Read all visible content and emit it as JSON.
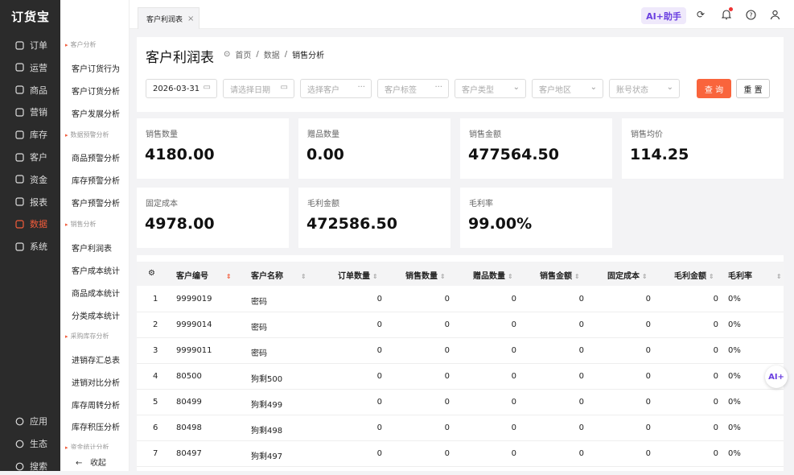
{
  "app": {
    "logo": "订货宝",
    "collapse": "收起"
  },
  "main_nav": [
    {
      "label": "订单",
      "icon": "order-icon"
    },
    {
      "label": "运营",
      "icon": "operation-icon"
    },
    {
      "label": "商品",
      "icon": "goods-icon"
    },
    {
      "label": "营销",
      "icon": "marketing-icon"
    },
    {
      "label": "库存",
      "icon": "warehouse-icon"
    },
    {
      "label": "客户",
      "icon": "customer-icon"
    },
    {
      "label": "资金",
      "icon": "money-icon"
    },
    {
      "label": "报表",
      "icon": "report-icon"
    },
    {
      "label": "数据",
      "icon": "data-icon",
      "active": true
    },
    {
      "label": "系统",
      "icon": "system-icon"
    }
  ],
  "bottom_nav": [
    {
      "label": "应用",
      "icon": "apps-icon"
    },
    {
      "label": "生态",
      "icon": "ecosystem-icon"
    },
    {
      "label": "搜索",
      "icon": "search-icon"
    }
  ],
  "sub_nav": {
    "groups": [
      "客户分析",
      "数据预警分析",
      "销售分析",
      "采购库存分析",
      "资金统计分析"
    ],
    "items": [
      "客户订货行为",
      "客户订货分析",
      "客户发展分析",
      "商品预警分析",
      "库存预警分析",
      "客户预警分析",
      "客户利润表",
      "客户成本统计",
      "商品成本统计",
      "分类成本统计",
      "进销存汇总表",
      "进销对比分析",
      "库存周转分析",
      "库存积压分析"
    ]
  },
  "tabs": [
    {
      "label": "客户利润表",
      "close": "×"
    }
  ],
  "header": {
    "ai_label": "AI+助手"
  },
  "page": {
    "title": "客户利润表",
    "breadcrumb": [
      "首页",
      "数据",
      "销售分析"
    ],
    "sep": "/"
  },
  "filters": {
    "date_start": "2026-03-31",
    "date_end_placeholder": "请选择日期",
    "customer_placeholder": "选择客户",
    "tag_placeholder": "客户标签",
    "type_placeholder": "客户类型",
    "region_placeholder": "客户地区",
    "status_placeholder": "账号状态",
    "query": "查 询",
    "reset": "重 置"
  },
  "stats": [
    {
      "label": "销售数量",
      "value": "4180.00"
    },
    {
      "label": "赠品数量",
      "value": "0.00"
    },
    {
      "label": "销售金额",
      "value": "477564.50"
    },
    {
      "label": "销售均价",
      "value": "114.25"
    },
    {
      "label": "固定成本",
      "value": "4978.00"
    },
    {
      "label": "毛利金额",
      "value": "472586.50"
    },
    {
      "label": "毛利率",
      "value": "99.00%"
    }
  ],
  "table": {
    "columns": [
      "客户编号",
      "客户名称",
      "订单数量",
      "销售数量",
      "赠品数量",
      "销售金额",
      "固定成本",
      "毛利金额",
      "毛利率"
    ],
    "rows": [
      [
        "1",
        "9999019",
        "密码",
        "0",
        "0",
        "0",
        "0",
        "0",
        "0",
        "0%"
      ],
      [
        "2",
        "9999014",
        "密码",
        "0",
        "0",
        "0",
        "0",
        "0",
        "0",
        "0%"
      ],
      [
        "3",
        "9999011",
        "密码",
        "0",
        "0",
        "0",
        "0",
        "0",
        "0",
        "0%"
      ],
      [
        "4",
        "80500",
        "狗剩500",
        "0",
        "0",
        "0",
        "0",
        "0",
        "0",
        "0%"
      ],
      [
        "5",
        "80499",
        "狗剩499",
        "0",
        "0",
        "0",
        "0",
        "0",
        "0",
        "0%"
      ],
      [
        "6",
        "80498",
        "狗剩498",
        "0",
        "0",
        "0",
        "0",
        "0",
        "0",
        "0%"
      ],
      [
        "7",
        "80497",
        "狗剩497",
        "0",
        "0",
        "0",
        "0",
        "0",
        "0",
        "0%"
      ]
    ]
  },
  "fab": {
    "label": "AI+"
  }
}
